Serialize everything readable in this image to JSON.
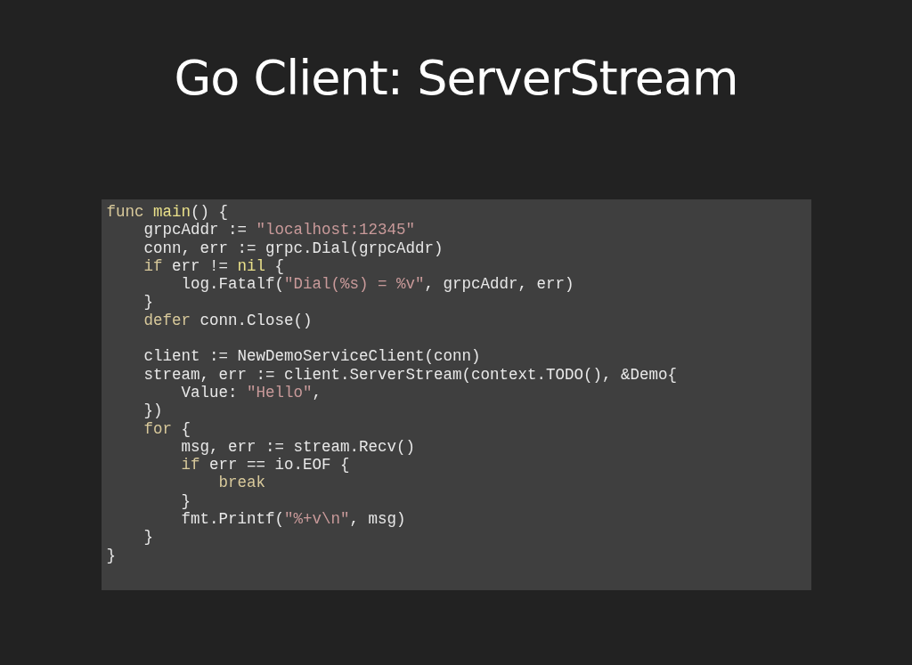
{
  "title": "Go Client: ServerStream",
  "code": {
    "lines": [
      {
        "tokens": [
          {
            "text": "func ",
            "kind": "keyword"
          },
          {
            "text": "main",
            "kind": "name"
          },
          {
            "text": "() {",
            "kind": "plain"
          }
        ]
      },
      {
        "tokens": [
          {
            "text": "    grpcAddr := ",
            "kind": "plain"
          },
          {
            "text": "\"localhost:12345\"",
            "kind": "string"
          }
        ]
      },
      {
        "tokens": [
          {
            "text": "    conn, err := grpc.Dial(grpcAddr)",
            "kind": "plain"
          }
        ]
      },
      {
        "tokens": [
          {
            "text": "    if",
            "kind": "keyword"
          },
          {
            "text": " err != ",
            "kind": "plain"
          },
          {
            "text": "nil",
            "kind": "name"
          },
          {
            "text": " {",
            "kind": "plain"
          }
        ]
      },
      {
        "tokens": [
          {
            "text": "        log.Fatalf(",
            "kind": "plain"
          },
          {
            "text": "\"Dial(%s) = %v\"",
            "kind": "string"
          },
          {
            "text": ", grpcAddr, err)",
            "kind": "plain"
          }
        ]
      },
      {
        "tokens": [
          {
            "text": "    }",
            "kind": "plain"
          }
        ]
      },
      {
        "tokens": [
          {
            "text": "    defer",
            "kind": "keyword"
          },
          {
            "text": " conn.Close()",
            "kind": "plain"
          }
        ]
      },
      {
        "blank_before": true,
        "tokens": [
          {
            "text": "    client := NewDemoServiceClient(conn)",
            "kind": "plain"
          }
        ]
      },
      {
        "tokens": [
          {
            "text": "    stream, err := client.ServerStream(context.TODO(), &Demo{",
            "kind": "plain"
          }
        ]
      },
      {
        "tokens": [
          {
            "text": "        Value: ",
            "kind": "plain"
          },
          {
            "text": "\"Hello\"",
            "kind": "string"
          },
          {
            "text": ",",
            "kind": "plain"
          }
        ]
      },
      {
        "tokens": [
          {
            "text": "    })",
            "kind": "plain"
          }
        ]
      },
      {
        "tokens": [
          {
            "text": "    for",
            "kind": "keyword"
          },
          {
            "text": " {",
            "kind": "plain"
          }
        ]
      },
      {
        "tokens": [
          {
            "text": "        msg, err := stream.Recv()",
            "kind": "plain"
          }
        ]
      },
      {
        "tokens": [
          {
            "text": "        if",
            "kind": "keyword"
          },
          {
            "text": " err == io.EOF {",
            "kind": "plain"
          }
        ]
      },
      {
        "tokens": [
          {
            "text": "            break",
            "kind": "keyword"
          }
        ]
      },
      {
        "tokens": [
          {
            "text": "        }",
            "kind": "plain"
          }
        ]
      },
      {
        "tokens": [
          {
            "text": "        fmt.Printf(",
            "kind": "plain"
          },
          {
            "text": "\"%+v\\n\"",
            "kind": "string"
          },
          {
            "text": ", msg)",
            "kind": "plain"
          }
        ]
      },
      {
        "tokens": [
          {
            "text": "    }",
            "kind": "plain"
          }
        ]
      },
      {
        "tokens": [
          {
            "text": "}",
            "kind": "plain"
          }
        ]
      }
    ]
  }
}
